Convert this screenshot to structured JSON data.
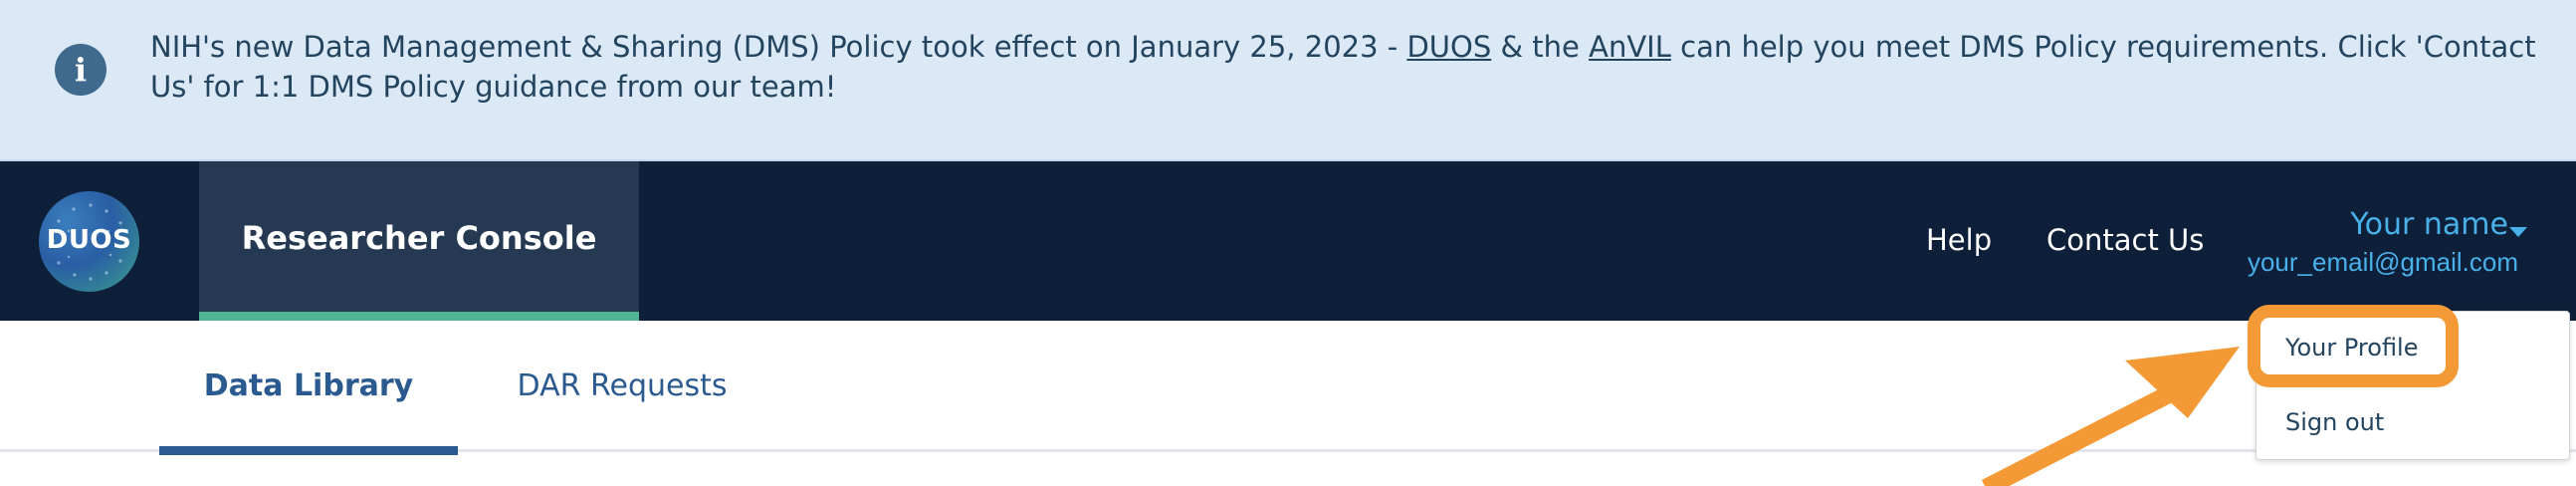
{
  "banner": {
    "text_before": "NIH's new Data Management & Sharing (DMS) Policy took effect on January 25, 2023 - ",
    "link1": "DUOS",
    "text_between": " & the ",
    "link2": "AnVIL",
    "text_after": " can help you meet DMS Policy requirements. Click 'Contact Us' for 1:1 DMS Policy guidance from our team!",
    "icon": "info-icon"
  },
  "navbar": {
    "logo_text": "DUOS",
    "console_label": "Researcher Console",
    "links": {
      "help": "Help",
      "contact": "Contact Us"
    },
    "user": {
      "name": "Your name",
      "email": "your_email@gmail.com"
    }
  },
  "subnav": {
    "tabs": [
      {
        "label": "Data Library",
        "active": true
      },
      {
        "label": "DAR Requests",
        "active": false
      }
    ]
  },
  "user_menu": {
    "items": [
      {
        "label": "Your Profile",
        "highlighted": true
      },
      {
        "label": "Sign out"
      }
    ]
  },
  "colors": {
    "banner_bg": "#dbe9f6",
    "navbar_bg": "#0e2039",
    "active_tab_bg": "#253a52",
    "accent_green": "#4fb593",
    "link_blue": "#4ab0ea",
    "tab_blue": "#2a5a8f",
    "annotation_orange": "#f39a36"
  }
}
